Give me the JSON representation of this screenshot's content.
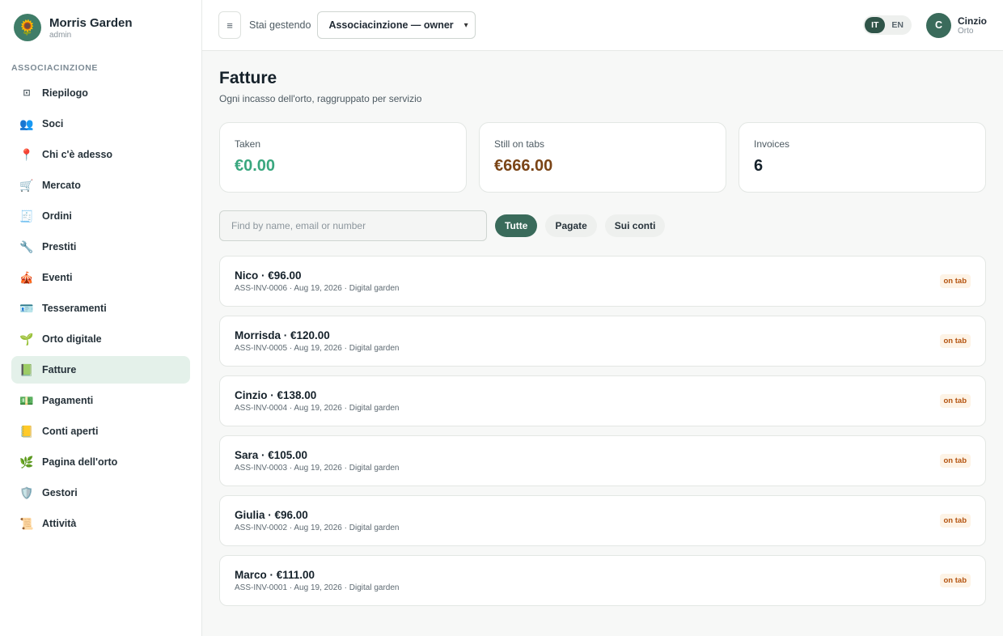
{
  "brand": {
    "name": "Morris Garden",
    "role": "admin",
    "logo_icon": "🌻"
  },
  "sidebar": {
    "section_label": "ASSOCIACINZIONE",
    "items": [
      {
        "label": "Riepilogo",
        "icon": "⊡",
        "icon_name": "dashboard-icon"
      },
      {
        "label": "Soci",
        "icon": "👥",
        "icon_name": "members-icon"
      },
      {
        "label": "Chi c'è adesso",
        "icon": "📍",
        "icon_name": "pin-icon"
      },
      {
        "label": "Mercato",
        "icon": "🛒",
        "icon_name": "cart-icon"
      },
      {
        "label": "Ordini",
        "icon": "🧾",
        "icon_name": "receipt-icon"
      },
      {
        "label": "Prestiti",
        "icon": "🔧",
        "icon_name": "wrench-icon"
      },
      {
        "label": "Eventi",
        "icon": "🎪",
        "icon_name": "circus-tent-icon"
      },
      {
        "label": "Tesseramenti",
        "icon": "🪪",
        "icon_name": "id-card-icon"
      },
      {
        "label": "Orto digitale",
        "icon": "🌱",
        "icon_name": "seedling-icon"
      },
      {
        "label": "Fatture",
        "icon": "📗",
        "icon_name": "green-book-icon",
        "active": true
      },
      {
        "label": "Pagamenti",
        "icon": "💵",
        "icon_name": "banknote-icon"
      },
      {
        "label": "Conti aperti",
        "icon": "📒",
        "icon_name": "ledger-icon"
      },
      {
        "label": "Pagina dell'orto",
        "icon": "🌿",
        "icon_name": "herb-icon"
      },
      {
        "label": "Gestori",
        "icon": "🛡️",
        "icon_name": "shield-icon"
      },
      {
        "label": "Attività",
        "icon": "📜",
        "icon_name": "scroll-icon"
      }
    ]
  },
  "topbar": {
    "menu_icon": "≡",
    "managing_label": "Stai gestendo",
    "org_select": "Associacinzione — owner",
    "lang": [
      "IT",
      "EN"
    ],
    "lang_active": "IT",
    "user": {
      "initial": "C",
      "name": "Cinzio",
      "sub": "Orto"
    }
  },
  "page": {
    "title": "Fatture",
    "subtitle": "Ogni incasso dell'orto, raggruppato per servizio"
  },
  "stats": [
    {
      "label": "Taken",
      "value": "€0.00",
      "color": "#3aa77f"
    },
    {
      "label": "Still on tabs",
      "value": "€666.00",
      "color": "#7a4416"
    },
    {
      "label": "Invoices",
      "value": "6",
      "color": "#15212a"
    }
  ],
  "search": {
    "placeholder": "Find by name, email or number",
    "value": ""
  },
  "filters": [
    "Tutte",
    "Pagate",
    "Sui conti"
  ],
  "filter_active": "Tutte",
  "invoices": [
    {
      "title": "Nico · €96.00",
      "meta": "ASS-INV-0006 · Aug 19, 2026 · Digital garden",
      "status": "on tab"
    },
    {
      "title": "Morrisda · €120.00",
      "meta": "ASS-INV-0005 · Aug 19, 2026 · Digital garden",
      "status": "on tab"
    },
    {
      "title": "Cinzio · €138.00",
      "meta": "ASS-INV-0004 · Aug 19, 2026 · Digital garden",
      "status": "on tab"
    },
    {
      "title": "Sara · €105.00",
      "meta": "ASS-INV-0003 · Aug 19, 2026 · Digital garden",
      "status": "on tab"
    },
    {
      "title": "Giulia · €96.00",
      "meta": "ASS-INV-0002 · Aug 19, 2026 · Digital garden",
      "status": "on tab"
    },
    {
      "title": "Marco · €111.00",
      "meta": "ASS-INV-0001 · Aug 19, 2026 · Digital garden",
      "status": "on tab"
    }
  ]
}
